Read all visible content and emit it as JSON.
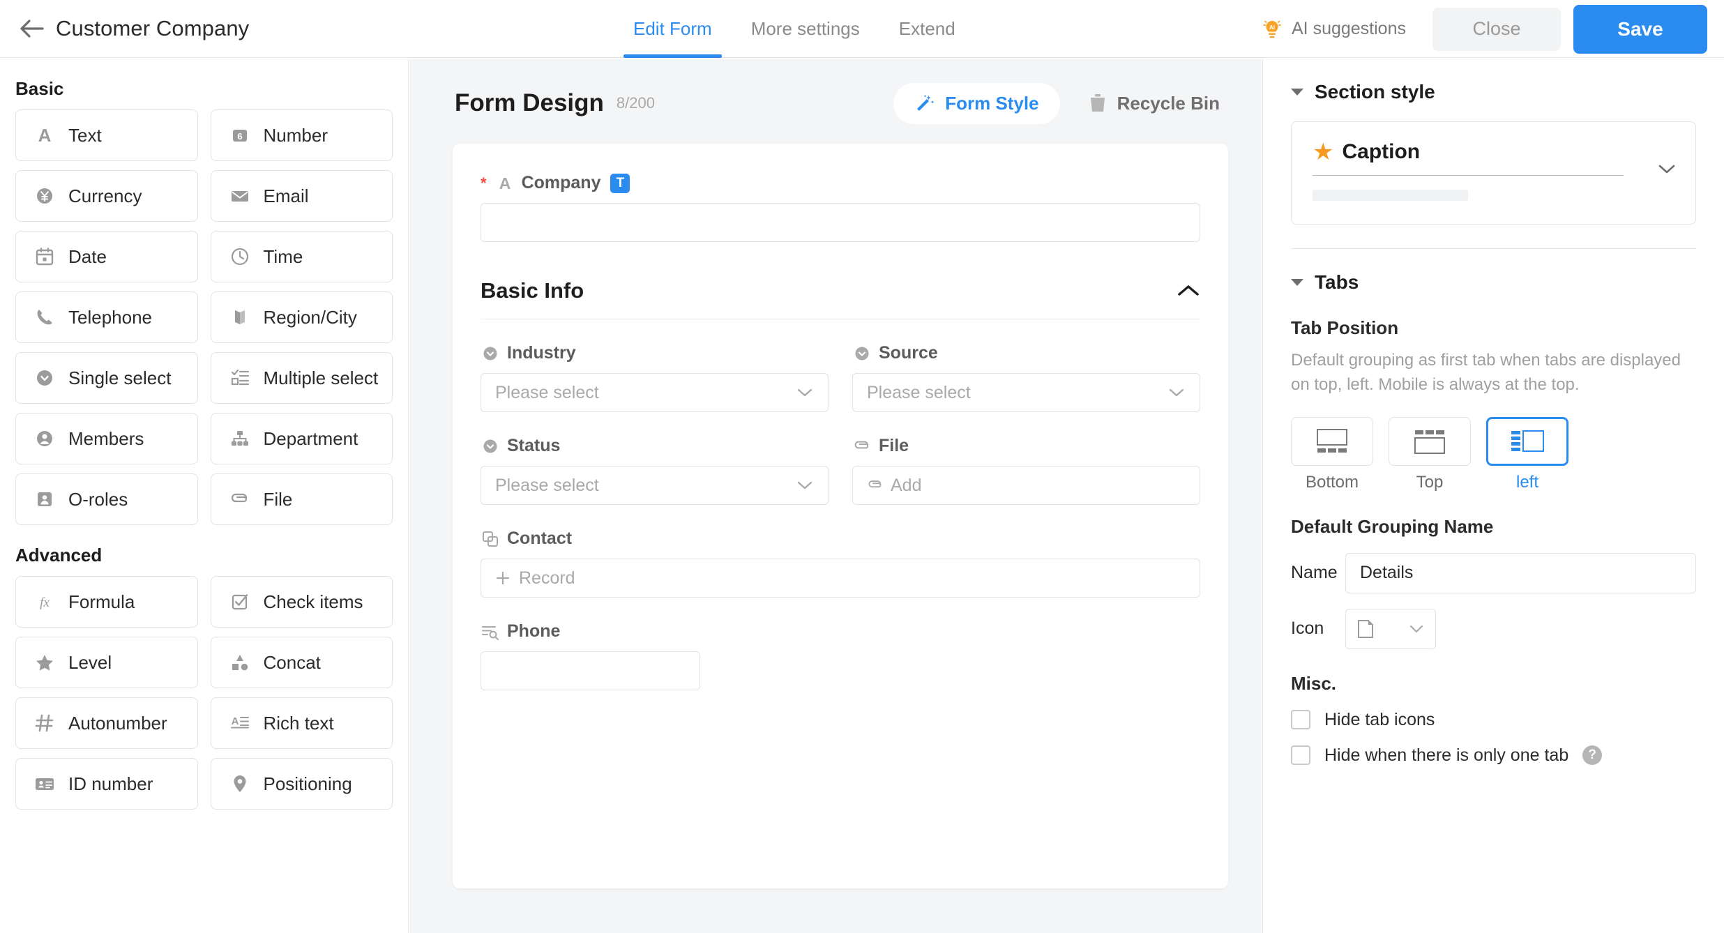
{
  "header": {
    "back_icon": "arrow-left-icon",
    "app_title": "Customer Company",
    "tabs": [
      {
        "label": "Edit Form",
        "active": true
      },
      {
        "label": "More settings",
        "active": false
      },
      {
        "label": "Extend",
        "active": false
      }
    ],
    "ai_suggestions": {
      "label": "AI suggestions",
      "icon": "ai-bulb-icon",
      "badge": "AI"
    },
    "close_label": "Close",
    "save_label": "Save",
    "accent_color": "#2b8cf0"
  },
  "sidebar": {
    "groups": [
      {
        "title": "Basic",
        "items": [
          {
            "label": "Text",
            "icon": "letter-a-icon"
          },
          {
            "label": "Number",
            "icon": "number-badge-icon"
          },
          {
            "label": "Currency",
            "icon": "currency-yen-icon"
          },
          {
            "label": "Email",
            "icon": "envelope-icon"
          },
          {
            "label": "Date",
            "icon": "calendar-icon"
          },
          {
            "label": "Time",
            "icon": "clock-icon"
          },
          {
            "label": "Telephone",
            "icon": "phone-icon"
          },
          {
            "label": "Region/City",
            "icon": "map-icon"
          },
          {
            "label": "Single select",
            "icon": "single-select-icon"
          },
          {
            "label": "Multiple select",
            "icon": "multiple-select-icon"
          },
          {
            "label": "Members",
            "icon": "user-circle-icon"
          },
          {
            "label": "Department",
            "icon": "org-chart-icon"
          },
          {
            "label": "O-roles",
            "icon": "id-person-icon"
          },
          {
            "label": "File",
            "icon": "paperclip-icon"
          }
        ]
      },
      {
        "title": "Advanced",
        "items": [
          {
            "label": "Formula",
            "icon": "fx-icon"
          },
          {
            "label": "Check items",
            "icon": "checkbox-checked-icon"
          },
          {
            "label": "Level",
            "icon": "star-icon"
          },
          {
            "label": "Concat",
            "icon": "shapes-icon"
          },
          {
            "label": "Autonumber",
            "icon": "hash-icon"
          },
          {
            "label": "Rich text",
            "icon": "rich-text-icon"
          },
          {
            "label": "ID number",
            "icon": "id-card-icon"
          },
          {
            "label": "Positioning",
            "icon": "location-pin-icon"
          }
        ]
      }
    ]
  },
  "center": {
    "title": "Form Design",
    "count": "8/200",
    "form_style_label": "Form Style",
    "form_style_icon": "magic-wand-icon",
    "recycle_bin_label": "Recycle Bin",
    "recycle_bin_icon": "trash-icon",
    "company_field": {
      "label": "Company",
      "required": true,
      "icon": "letter-a-icon",
      "badge": "T",
      "value": ""
    },
    "section": {
      "title": "Basic Info",
      "collapse_icon": "chevron-up-icon",
      "fields": [
        {
          "label": "Industry",
          "icon": "single-select-icon",
          "type": "select",
          "placeholder": "Please select",
          "value": ""
        },
        {
          "label": "Source",
          "icon": "single-select-icon",
          "type": "select",
          "placeholder": "Please select",
          "value": ""
        },
        {
          "label": "Status",
          "icon": "single-select-icon",
          "type": "select",
          "placeholder": "Please select",
          "value": ""
        },
        {
          "label": "File",
          "icon": "paperclip-icon",
          "type": "file",
          "placeholder": "Add",
          "value": ""
        },
        {
          "label": "Contact",
          "icon": "related-record-icon",
          "type": "record",
          "placeholder": "Record",
          "value": ""
        },
        {
          "label": "Phone",
          "icon": "lookup-icon",
          "type": "text",
          "placeholder": "",
          "value": ""
        }
      ]
    }
  },
  "right_panel": {
    "section_style": {
      "title": "Section style",
      "caption_label": "Caption",
      "caption_icon": "star-icon",
      "expand_icon": "chevron-down-icon"
    },
    "tabs_section": {
      "title": "Tabs",
      "tab_position_label": "Tab Position",
      "tab_position_desc": "Default grouping as first tab when tabs are displayed on top, left. Mobile is always at the top.",
      "options": [
        {
          "label": "Bottom",
          "active": false
        },
        {
          "label": "Top",
          "active": false
        },
        {
          "label": "left",
          "active": true
        }
      ],
      "default_grouping_label": "Default Grouping Name",
      "name_label": "Name",
      "name_value": "Details",
      "icon_label": "Icon",
      "icon_value": "page-icon",
      "misc_label": "Misc.",
      "checkboxes": [
        {
          "label": "Hide tab icons",
          "checked": false,
          "help": false
        },
        {
          "label": "Hide when there is only one tab",
          "checked": false,
          "help": true,
          "help_glyph": "?"
        }
      ]
    }
  }
}
